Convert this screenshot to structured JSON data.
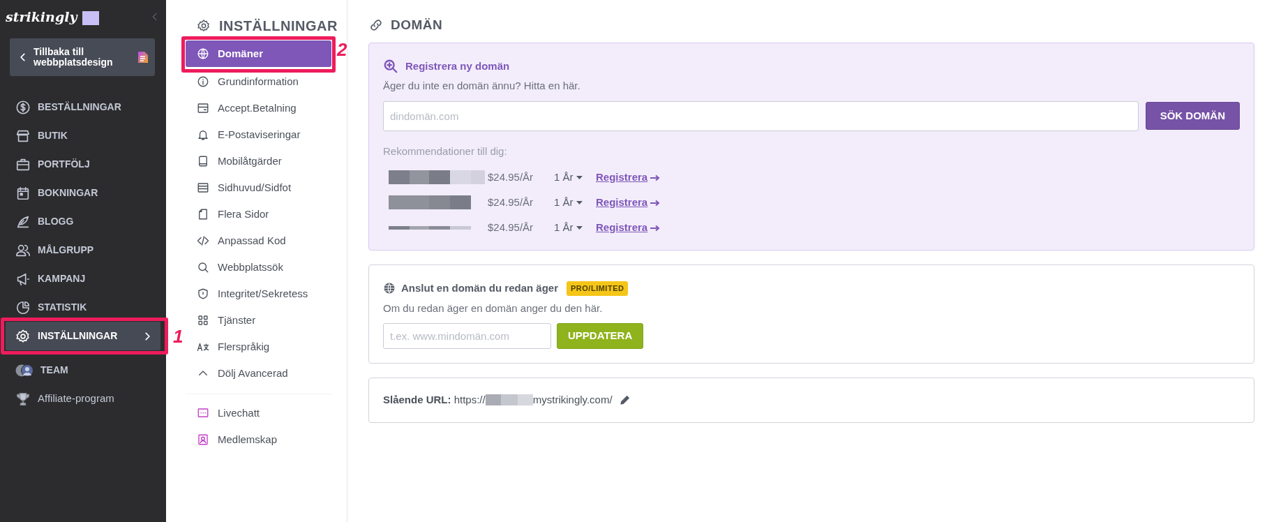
{
  "sidebar": {
    "logo": "strikingly",
    "back_button": "Tillbaka till webbplatsdesign",
    "callout": "1",
    "items": [
      {
        "label": "BESTÄLLNINGAR",
        "kind": "section",
        "selected": false
      },
      {
        "label": "BUTIK",
        "kind": "section",
        "selected": false
      },
      {
        "label": "PORTFÖLJ",
        "kind": "section",
        "selected": false
      },
      {
        "label": "BOKNINGAR",
        "kind": "section",
        "selected": false
      },
      {
        "label": "BLOGG",
        "kind": "section",
        "selected": false
      },
      {
        "label": "MÅLGRUPP",
        "kind": "section",
        "selected": false
      },
      {
        "label": "KAMPANJ",
        "kind": "section",
        "selected": false
      },
      {
        "label": "STATISTIK",
        "kind": "section",
        "selected": false
      },
      {
        "label": "INSTÄLLNINGAR",
        "kind": "section",
        "selected": true
      },
      {
        "label": "TEAM",
        "kind": "section",
        "selected": false
      },
      {
        "label": "Affiliate-program",
        "kind": "link",
        "selected": false
      }
    ]
  },
  "settings_menu": {
    "title": "INSTÄLLNINGAR",
    "callout": "2",
    "items": [
      {
        "label": "Domäner",
        "selected": true
      },
      {
        "label": "Grundinformation",
        "selected": false
      },
      {
        "label": "Accept.Betalning",
        "selected": false
      },
      {
        "label": "E-Postaviseringar",
        "selected": false
      },
      {
        "label": "Mobilåtgärder",
        "selected": false
      },
      {
        "label": "Sidhuvud/Sidfot",
        "selected": false
      },
      {
        "label": "Flera Sidor",
        "selected": false
      },
      {
        "label": "Anpassad Kod",
        "selected": false
      },
      {
        "label": "Webbplatssök",
        "selected": false
      },
      {
        "label": "Integritet/Sekretess",
        "selected": false
      },
      {
        "label": "Tjänster",
        "selected": false
      },
      {
        "label": "Flerspråkig",
        "selected": false
      },
      {
        "label": "Dölj Avancerad",
        "selected": false
      }
    ],
    "extra_items": [
      {
        "label": "Livechatt"
      },
      {
        "label": "Medlemskap"
      }
    ]
  },
  "main": {
    "title": "DOMÄN",
    "register": {
      "title": "Registrera ny domän",
      "subtitle": "Äger du inte en domän ännu? Hitta en här.",
      "placeholder": "dindomän.com",
      "button": "SÖK DOMÄN",
      "recommendations_label": "Rekommendationer till dig:",
      "rows": [
        {
          "price": "$24.95/År",
          "term": "1 År",
          "link": "Registrera"
        },
        {
          "price": "$24.95/År",
          "term": "1 År",
          "link": "Registrera"
        },
        {
          "price": "$24.95/År",
          "term": "1 År",
          "link": "Registrera"
        }
      ]
    },
    "connect": {
      "title": "Anslut en domän du redan äger",
      "badge": "PRO/LIMITED",
      "subtitle": "Om du redan äger en domän anger du den här.",
      "placeholder": "t.ex. www.mindomän.com",
      "button": "UPPDATERA"
    },
    "url": {
      "label": "**Slående URL:** https://",
      "suffix": "mystrikingly.com/"
    }
  }
}
